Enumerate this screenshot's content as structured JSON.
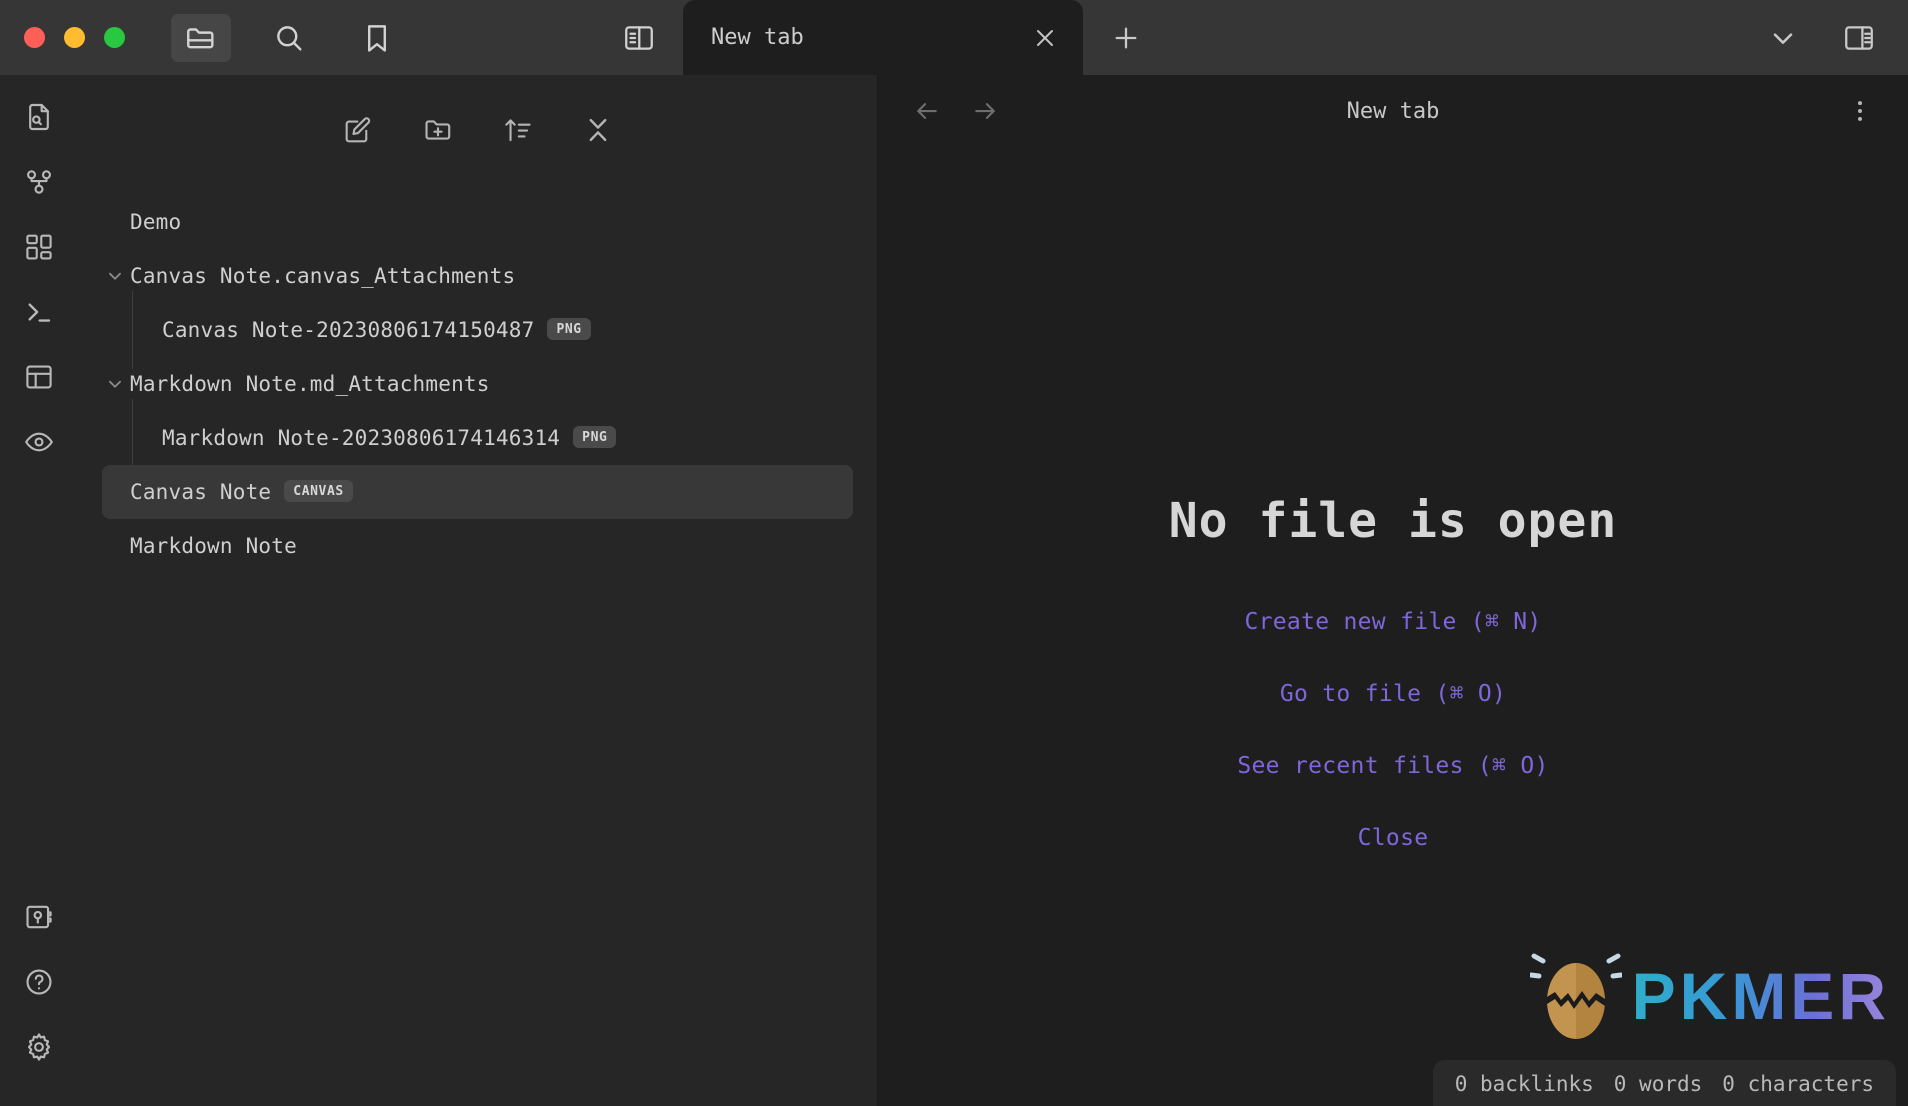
{
  "window": {
    "traffic_lights": [
      {
        "name": "close",
        "color": "#ff5f57"
      },
      {
        "name": "minimize",
        "color": "#febc2e"
      },
      {
        "name": "zoom",
        "color": "#28c840"
      }
    ]
  },
  "titlebar": {
    "buttons": [
      {
        "name": "folder-icon",
        "label": "Open folder",
        "active": true
      },
      {
        "name": "search-icon",
        "label": "Search"
      },
      {
        "name": "bookmark-icon",
        "label": "Bookmarks"
      }
    ],
    "left_sidebar_toggle_label": "Toggle left sidebar",
    "tab": {
      "title": "New tab",
      "close_label": "Close tab"
    },
    "new_tab_label": "New tab",
    "chevron_label": "Tab list",
    "right_sidebar_toggle_label": "Toggle right sidebar"
  },
  "ribbon": {
    "top_items": [
      {
        "name": "file-search-icon",
        "label": "Quick switcher"
      },
      {
        "name": "graph-view-icon",
        "label": "Open graph view"
      },
      {
        "name": "canvas-icon",
        "label": "Create new canvas"
      },
      {
        "name": "terminal-icon",
        "label": "Open terminal"
      },
      {
        "name": "layout-icon",
        "label": "Open layout"
      },
      {
        "name": "eye-icon",
        "label": "Toggle reading view"
      }
    ],
    "bottom_items": [
      {
        "name": "vault-icon",
        "label": "Open another vault"
      },
      {
        "name": "help-icon",
        "label": "Help"
      },
      {
        "name": "settings-icon",
        "label": "Settings"
      }
    ]
  },
  "explorer": {
    "toolbar": [
      {
        "name": "new-note-icon",
        "label": "New note"
      },
      {
        "name": "new-folder-icon",
        "label": "New folder"
      },
      {
        "name": "sort-icon",
        "label": "Change sort order"
      },
      {
        "name": "collapse-icon",
        "label": "Collapse all"
      }
    ],
    "tree": [
      {
        "label": "Demo",
        "type": "folder-root",
        "depth": 0,
        "chevron": "",
        "badge": "",
        "selected": false,
        "guide": false
      },
      {
        "label": "Canvas Note.canvas_Attachments",
        "type": "folder",
        "depth": 0,
        "chevron": "⌄",
        "badge": "",
        "selected": false,
        "guide": false
      },
      {
        "label": "Canvas Note-20230806174150487",
        "type": "file",
        "depth": 1,
        "chevron": "",
        "badge": "PNG",
        "selected": false,
        "guide": true
      },
      {
        "label": "Markdown Note.md_Attachments",
        "type": "folder",
        "depth": 0,
        "chevron": "⌄",
        "badge": "",
        "selected": false,
        "guide": false
      },
      {
        "label": "Markdown Note-20230806174146314",
        "type": "file",
        "depth": 1,
        "chevron": "",
        "badge": "PNG",
        "selected": false,
        "guide": true
      },
      {
        "label": "Canvas Note",
        "type": "file",
        "depth": 0,
        "chevron": "",
        "badge": "CANVAS",
        "selected": true,
        "guide": false
      },
      {
        "label": "Markdown Note",
        "type": "file",
        "depth": 0,
        "chevron": "",
        "badge": "",
        "selected": false,
        "guide": false
      }
    ]
  },
  "main": {
    "nav": {
      "back_label": "Navigate back",
      "forward_label": "Navigate forward",
      "more_label": "More options"
    },
    "view_title": "New tab",
    "empty_state": {
      "title": "No file is open",
      "actions": [
        "Create new file (⌘ N)",
        "Go to file (⌘ O)",
        "See recent files (⌘ O)",
        "Close"
      ]
    }
  },
  "watermark": {
    "text": "PKMER",
    "icon": "cracked-egg-icon",
    "gradient_start": "#2fb6d4",
    "gradient_end": "#9f8ce6"
  },
  "statusbar": {
    "backlinks": "0 backlinks",
    "words": "0 words",
    "characters": "0 characters"
  },
  "colors": {
    "titlebar_bg": "#363636",
    "sidebar_bg": "#262626",
    "main_bg": "#1e1e1e",
    "accent": "#7e67d8",
    "selected_row": "#383838"
  }
}
